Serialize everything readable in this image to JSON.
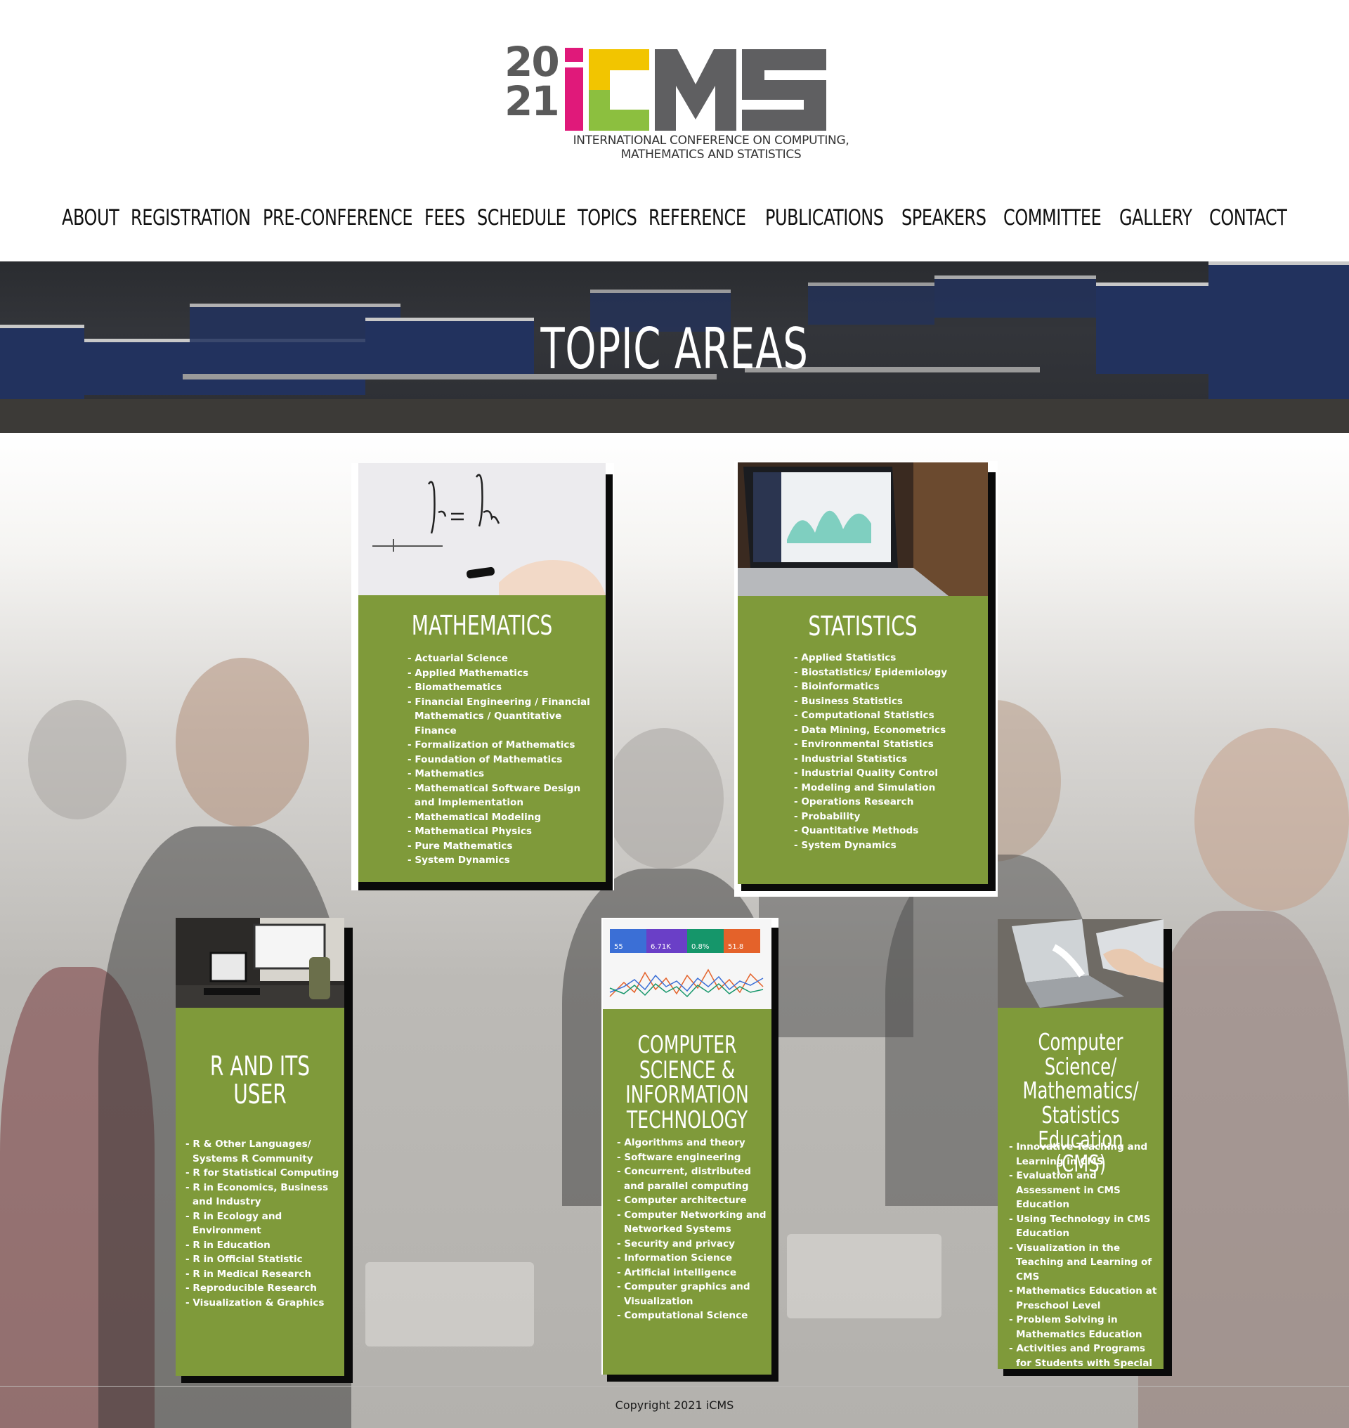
{
  "logo": {
    "year_top": "20",
    "year_bottom": "21",
    "mark": "iCMS",
    "subtitle_line1": "INTERNATIONAL CONFERENCE ON COMPUTING,",
    "subtitle_line2": "MATHEMATICS AND STATISTICS"
  },
  "nav": [
    "ABOUT",
    "REGISTRATION",
    "PRE-CONFERENCE",
    "FEES",
    "SCHEDULE",
    "TOPICS",
    "REFERENCE",
    "PUBLICATIONS",
    "SPEAKERS",
    "COMMITTEE",
    "GALLERY",
    "CONTACT"
  ],
  "hero": {
    "title": "TOPIC AREAS"
  },
  "colors": {
    "card_green": "#7f9a3a",
    "logo_gray": "#5a5a5a",
    "logo_pink": "#e0197a",
    "logo_yellow": "#f2c500",
    "logo_green": "#8cbf3f"
  },
  "cards": [
    {
      "title": "MATHEMATICS",
      "image": "whiteboard-equation",
      "items": [
        "Actuarial Science",
        "Applied Mathematics",
        "Biomathematics",
        "Financial Engineering / Financial Mathematics / Quantitative Finance",
        "Formalization of Mathematics",
        "Foundation of Mathematics",
        "Mathematics",
        "Mathematical Software Design and Implementation",
        "Mathematical Modeling",
        "Mathematical Physics",
        "Pure Mathematics",
        "System Dynamics"
      ]
    },
    {
      "title": "STATISTICS",
      "image": "laptop-dashboard",
      "items": [
        "Applied Statistics",
        "Biostatistics/ Epidemiology",
        "Bioinformatics",
        "Business Statistics",
        "Computational Statistics",
        "Data Mining, Econometrics",
        "Environmental Statistics",
        "Industrial Statistics",
        "Industrial Quality Control",
        "Modeling and Simulation",
        "Operations Research",
        "Probability",
        "Quantitative Methods",
        "System Dynamics"
      ]
    },
    {
      "title": "R AND ITS USER",
      "image": "desktop-workstation",
      "items": [
        "R & Other Languages/ Systems R Community",
        "R for Statistical Computing",
        "R in Economics, Business and Industry",
        "R in Ecology and Environment",
        "R in Education",
        "R in Official Statistic",
        "R in Medical Research",
        "Reproducible Research",
        "Visualization & Graphics"
      ]
    },
    {
      "title": "COMPUTER SCIENCE & INFORMATION TECHNOLOGY",
      "image": "analytics-chart",
      "image_stats": [
        "55",
        "6.71K",
        "0.8%",
        "51.8"
      ],
      "items": [
        "Algorithms and theory",
        "Software engineering",
        "Concurrent, distributed and parallel computing",
        "Computer architecture",
        "Computer Networking and Networked Systems",
        "Security and privacy",
        "Information Science",
        "Artificial intelligence",
        "Computer graphics and Visualization",
        "Computational Science"
      ]
    },
    {
      "title": "Computer Science/ Mathematics/ Statistics Education (CMS)",
      "image": "laptop-meeting",
      "items": [
        "Innovative Teaching and Learning in CMS",
        "Evaluation and Assessment in CMS Education",
        "Using Technology in CMS Education",
        "Visualization in the Teaching and Learning of CMS",
        "Mathematics Education at Preschool Level",
        "Problem Solving in Mathematics Education",
        "Activities and Programs for Students with Special Needs"
      ]
    }
  ],
  "footer": {
    "copyright": "Copyright 2021 iCMS"
  }
}
